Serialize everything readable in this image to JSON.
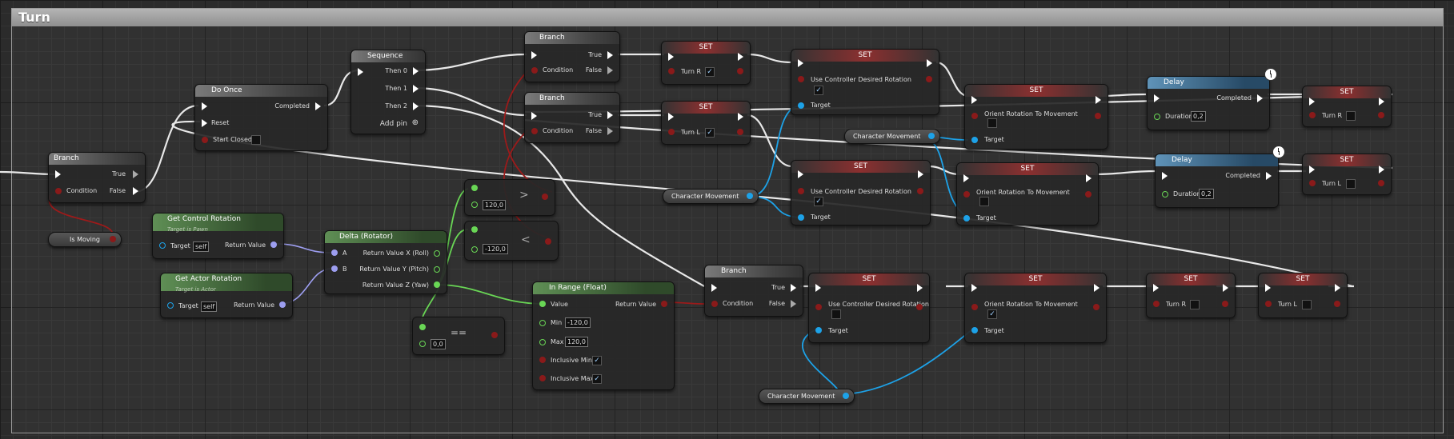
{
  "graph": {
    "comment_title": "Turn"
  },
  "nodes": {
    "branch_main": {
      "title": "Branch",
      "true": "True",
      "false": "False",
      "cond": "Condition"
    },
    "is_moving": {
      "label": "Is Moving"
    },
    "do_once": {
      "title": "Do Once",
      "completed": "Completed",
      "reset": "Reset",
      "start_closed": "Start Closed"
    },
    "sequence": {
      "title": "Sequence",
      "then0": "Then 0",
      "then1": "Then 1",
      "then2": "Then 2",
      "add_pin": "Add pin"
    },
    "branch_top": {
      "title": "Branch",
      "true": "True",
      "false": "False",
      "cond": "Condition"
    },
    "branch_mid": {
      "title": "Branch",
      "true": "True",
      "false": "False",
      "cond": "Condition"
    },
    "set_turn_r_top": {
      "title": "SET",
      "label": "Turn R"
    },
    "set_turn_l_mid": {
      "title": "SET",
      "label": "Turn L"
    },
    "set_ucdr_1": {
      "title": "SET",
      "prop": "Use Controller Desired Rotation",
      "target": "Target"
    },
    "set_ucdr_2": {
      "title": "SET",
      "prop": "Use Controller Desired Rotation",
      "target": "Target"
    },
    "set_ucdr_3": {
      "title": "SET",
      "prop": "Use Controller Desired Rotation",
      "target": "Target"
    },
    "set_ortm_1": {
      "title": "SET",
      "prop": "Orient Rotation To Movement",
      "target": "Target"
    },
    "set_ortm_2": {
      "title": "SET",
      "prop": "Orient Rotation To Movement",
      "target": "Target"
    },
    "set_ortm_3": {
      "title": "SET",
      "prop": "Orient Rotation To Movement",
      "target": "Target"
    },
    "char_move_1": {
      "label": "Character Movement"
    },
    "char_move_2": {
      "label": "Character Movement"
    },
    "char_move_3": {
      "label": "Character Movement"
    },
    "delay_1": {
      "title": "Delay",
      "completed": "Completed",
      "duration_label": "Duration",
      "duration": "0,2"
    },
    "delay_2": {
      "title": "Delay",
      "completed": "Completed",
      "duration_label": "Duration",
      "duration": "0,2"
    },
    "set_turn_r_right": {
      "title": "SET",
      "label": "Turn R"
    },
    "set_turn_l_right": {
      "title": "SET",
      "label": "Turn L"
    },
    "get_control_rot": {
      "title": "Get Control Rotation",
      "sub": "Target is Pawn",
      "target": "Target",
      "self": "self",
      "ret": "Return Value"
    },
    "get_actor_rot": {
      "title": "Get Actor Rotation",
      "sub": "Target is Actor",
      "target": "Target",
      "self": "self",
      "ret": "Return Value"
    },
    "delta_rot": {
      "title": "Delta (Rotator)",
      "a": "A",
      "b": "B",
      "x": "Return Value X (Roll)",
      "y": "Return Value Y (Pitch)",
      "z": "Return Value Z (Yaw)"
    },
    "cmp_gt": {
      "value": "120,0",
      "op": ">"
    },
    "cmp_lt": {
      "value": "-120,0",
      "op": "<"
    },
    "cmp_eq": {
      "value": "0,0",
      "op": "=="
    },
    "in_range": {
      "title": "In Range (Float)",
      "value": "Value",
      "ret": "Return Value",
      "min": "Min",
      "min_v": "-120,0",
      "max": "Max",
      "max_v": "120,0",
      "inc_min": "Inclusive Min",
      "inc_max": "Inclusive Max"
    },
    "branch_low": {
      "title": "Branch",
      "true": "True",
      "false": "False",
      "cond": "Condition"
    },
    "set_turn_r_low": {
      "title": "SET",
      "label": "Turn R"
    },
    "set_turn_l_low": {
      "title": "SET",
      "label": "Turn L"
    }
  },
  "colors": {
    "exec": "#ffffff",
    "bool": "#8a1a1a",
    "object": "#1da2e8",
    "float": "#69d655",
    "struct": "#9d9ef0"
  },
  "icons": {
    "check": "✓"
  }
}
